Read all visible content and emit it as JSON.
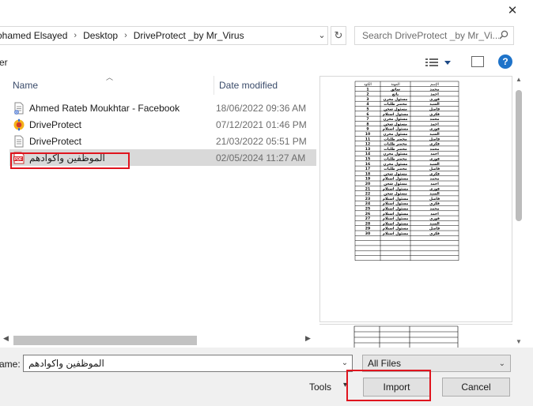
{
  "window": {
    "close_glyph": "✕"
  },
  "address_bar": {
    "crumbs": [
      "ohamed Elsayed",
      "Desktop",
      "DriveProtect _by Mr_Virus"
    ],
    "separator": "›"
  },
  "search": {
    "placeholder": "Search DriveProtect _by Mr_Vi..."
  },
  "toolbar": {
    "truncated_label": "er"
  },
  "columns": {
    "name": "Name",
    "date_modified": "Date modified"
  },
  "files": [
    {
      "name": "Ahmed Rateb Moukhtar - Facebook",
      "date": "18/06/2022 09:36 AM",
      "icon": "text-file-icon"
    },
    {
      "name": "DriveProtect",
      "date": "07/12/2021 01:46 PM",
      "icon": "app-icon"
    },
    {
      "name": "DriveProtect",
      "date": "21/03/2022 05:51 PM",
      "icon": "text-file-icon"
    },
    {
      "name": "الموظفين واكوادهم",
      "date": "02/05/2024 11:27 AM",
      "icon": "pdf-file-icon",
      "selected": true
    }
  ],
  "preview": {
    "headers": [
      "الكود",
      "المهنة",
      "الإسم"
    ],
    "rows": [
      [
        "1",
        "سائق",
        "محمد"
      ],
      [
        "2",
        "بائع",
        "احمد"
      ],
      [
        "3",
        "مسئول مخزن",
        "فوزي"
      ],
      [
        "4",
        "محضر طلبات",
        "السيد"
      ],
      [
        "5",
        "مسئول شحن",
        "فاضل"
      ],
      [
        "6",
        "مسئول استلام",
        "فكري"
      ],
      [
        "7",
        "مسئول مخزن",
        "محمد"
      ],
      [
        "8",
        "مسئول شحن",
        "احمد"
      ],
      [
        "9",
        "مسئول استلام",
        "فوزي"
      ],
      [
        "10",
        "مسئول مخزن",
        "السيد"
      ],
      [
        "11",
        "محضر طلبات",
        "فاضل"
      ],
      [
        "12",
        "محضر طلبات",
        "فكري"
      ],
      [
        "13",
        "محضر طلبات",
        "محمد"
      ],
      [
        "14",
        "مسئول مخزن",
        "احمد"
      ],
      [
        "15",
        "محضر طلبات",
        "فوزي"
      ],
      [
        "16",
        "مسئول مخزن",
        "السيد"
      ],
      [
        "17",
        "محضر طلبات",
        "فاضل"
      ],
      [
        "18",
        "مسئول شحن",
        "فكري"
      ],
      [
        "19",
        "مسئول استلام",
        "محمد"
      ],
      [
        "20",
        "مسئول شحن",
        "احمد"
      ],
      [
        "21",
        "مسئول استلام",
        "فوزي"
      ],
      [
        "22",
        "مسئول شحن",
        "السيد"
      ],
      [
        "23",
        "مسئول استلام",
        "فاضل"
      ],
      [
        "24",
        "مسئول استلام",
        "فكري"
      ],
      [
        "25",
        "مسئول استلام",
        "محمد"
      ],
      [
        "26",
        "مسئول استلام",
        "احمد"
      ],
      [
        "27",
        "مسئول استلام",
        "فوزي"
      ],
      [
        "28",
        "مسئول استلام",
        "السيد"
      ],
      [
        "29",
        "مسئول استلام",
        "فاضل"
      ],
      [
        "30",
        "مسئول استلام",
        "فكري"
      ]
    ]
  },
  "footer": {
    "filename_label": "ame:",
    "filename_value": "الموظفين واكوادهم",
    "filetype": "All Files",
    "tools_label": "Tools",
    "import_label": "Import",
    "cancel_label": "Cancel"
  },
  "colors": {
    "highlight": "#e0141e",
    "help": "#1e73c9",
    "selection": "#d9d9d9"
  }
}
